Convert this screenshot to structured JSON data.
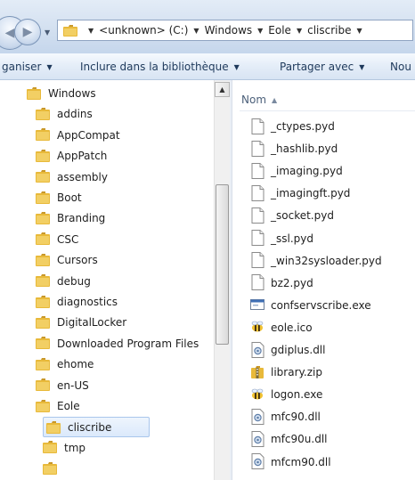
{
  "address": {
    "crumbs": [
      "<unknown> (C:)",
      "Windows",
      "Eole",
      "cliscribe"
    ]
  },
  "toolbar": {
    "organize": "ganiser",
    "include": "Inclure dans la bibliothèque",
    "share": "Partager avec",
    "new": "Nou"
  },
  "nav": {
    "root": "Windows",
    "items": [
      "addins",
      "AppCompat",
      "AppPatch",
      "assembly",
      "Boot",
      "Branding",
      "CSC",
      "Cursors",
      "debug",
      "diagnostics",
      "DigitalLocker",
      "Downloaded Program Files",
      "ehome",
      "en-US",
      "Eole"
    ],
    "sub": [
      "cliscribe",
      "tmp"
    ],
    "selected": "cliscribe"
  },
  "files": {
    "column": "Nom",
    "items": [
      {
        "name": "_ctypes.pyd",
        "icon": "blank-file-icon"
      },
      {
        "name": "_hashlib.pyd",
        "icon": "blank-file-icon"
      },
      {
        "name": "_imaging.pyd",
        "icon": "blank-file-icon"
      },
      {
        "name": "_imagingft.pyd",
        "icon": "blank-file-icon"
      },
      {
        "name": "_socket.pyd",
        "icon": "blank-file-icon"
      },
      {
        "name": "_ssl.pyd",
        "icon": "blank-file-icon"
      },
      {
        "name": "_win32sysloader.pyd",
        "icon": "blank-file-icon"
      },
      {
        "name": "bz2.pyd",
        "icon": "blank-file-icon"
      },
      {
        "name": "confservscribe.exe",
        "icon": "exe-window-icon"
      },
      {
        "name": "eole.ico",
        "icon": "eole-bee-icon"
      },
      {
        "name": "gdiplus.dll",
        "icon": "dll-gear-icon"
      },
      {
        "name": "library.zip",
        "icon": "zip-folder-icon"
      },
      {
        "name": "logon.exe",
        "icon": "eole-bee-icon"
      },
      {
        "name": "mfc90.dll",
        "icon": "dll-gear-icon"
      },
      {
        "name": "mfc90u.dll",
        "icon": "dll-gear-icon"
      },
      {
        "name": "mfcm90.dll",
        "icon": "dll-gear-icon"
      }
    ]
  },
  "colors": {
    "folder": "#e8b93a",
    "selection": "#dbe9fb",
    "toolbar_text": "#1e395b"
  }
}
